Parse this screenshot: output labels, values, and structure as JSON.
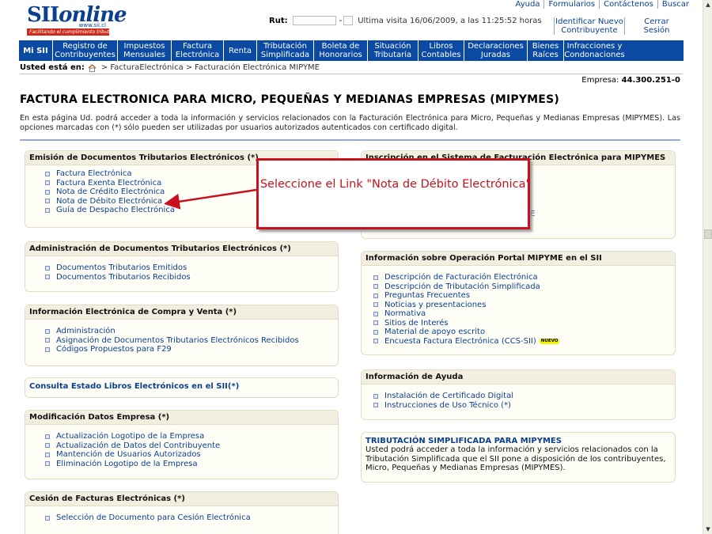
{
  "header": {
    "logo_word": "SIIonline",
    "logo_domain": "www.sii.cl",
    "logo_tagline": "Facilitando el cumplimiento tributario",
    "top_links": [
      "Ayuda",
      "Formularios",
      "Contáctenos",
      "Buscar"
    ],
    "rut_label": "Rut:",
    "rut_sep": "-",
    "last_visit": "Ultima visita 16/06/2009, a las 11:25:52 horas",
    "identify_link": "Identificar Nuevo Contribuyente",
    "logout_link": "Cerrar Sesión"
  },
  "nav": {
    "items": [
      "Mi SII",
      "Registro de Contribuyentes",
      "Impuestos Mensuales",
      "Factura Electrónica",
      "Renta",
      "Tributación Simplificada",
      "Boleta de Honorarios",
      "Situación Tributaria",
      "Libros Contables",
      "Declaraciones Juradas",
      "Bienes Raíces",
      "Infracciones y Condonaciones"
    ]
  },
  "breadcrumb": {
    "lead": "Usted está en:",
    "crumbs": [
      "FacturaElectrónica",
      "Facturación Electrónica MIPYME"
    ]
  },
  "empresa": {
    "label": "Empresa:",
    "value": "44.300.251-0"
  },
  "page": {
    "title": "FACTURA ELECTRONICA PARA MICRO, PEQUEÑAS Y MEDIANAS EMPRESAS (MIPYMES)",
    "intro": "En esta página Ud. podrá acceder a toda la información y servicios relacionados con la Facturación Electrónica para Micro, Pequeñas y Medianas Empresas (MIPYMES). Las opciones marcadas con (*) sólo pueden ser utilizadas por usuarios autorizados autenticados con certificado digital."
  },
  "panels_left": [
    {
      "title": "Emisión de Documentos Tributarios Electrónicos (*)",
      "links": [
        "Factura Electrónica",
        "Factura Exenta Electrónica",
        "Nota de Crédito Electrónica",
        "Nota de Débito Electrónica",
        "Guía de Despacho Electrónica"
      ]
    },
    {
      "title": "Administración de Documentos Tributarios Electrónicos (*)",
      "links": [
        "Documentos Tributarios Emitidos",
        "Documentos Tributarios Recibidos"
      ]
    },
    {
      "title": "Información Electrónica de Compra y Venta (*)",
      "links": [
        "Administración",
        "Asignación de Documentos Tributarios Electrónicos Recibidos",
        "Códigos Propuestos para F29"
      ]
    },
    {
      "title": "Consulta Estado Libros Electrónicos en el SII(*)",
      "links": []
    },
    {
      "title": "Modificación Datos Empresa (*)",
      "links": [
        "Actualización Logotipo de la Empresa",
        "Actualización de Datos del Contribuyente",
        "Mantención de Usuarios Autorizados",
        "Eliminación Logotipo de la Empresa"
      ]
    },
    {
      "title": "Cesión de Facturas Electrónicas (*)",
      "links": [
        "Selección de Documento para Cesión Electrónica"
      ]
    }
  ],
  "panels_right": [
    {
      "title": "Inscripción en el Sistema de Facturación Electrónica para MIPYMES",
      "links": [],
      "partial_link": "E"
    },
    {
      "title": "Información sobre Operación Portal MIPYME en el SII",
      "links": [
        "Descripción de Facturación Electrónica",
        "Descripción de Tributación Simplificada",
        "Preguntas Frecuentes",
        "Noticias y presentaciones",
        "Normativa",
        "Sitios de Interés",
        "Material de apoyo escrito",
        "Encuesta Factura Electrónica (CCS-SII)"
      ],
      "badge": "NUEVO"
    },
    {
      "title": "Información de Ayuda",
      "links": [
        "Instalación de Certificado Digital",
        "Instrucciones de Uso Técnico (*)"
      ]
    },
    {
      "title": "TRIBUTACIÓN SIMPLIFICADA PARA MIPYMES",
      "text": "Usted podrá acceder a toda la información y servicios relacionados con la Tributación Simplificada que el SII pone a disposición de los contribuyentes, Micro, Pequeñas y Medianas Empresas (MIPYMES)."
    }
  ],
  "callout": {
    "text": "Seleccione el Link \"Nota de Débito Electrónica\""
  },
  "colors": {
    "brand_blue": "#0b4aa2",
    "callout_red": "#c8101e",
    "link_blue": "#0a3f91",
    "panel_bg": "#fffef6"
  },
  "icons": {
    "home": "home-icon",
    "bullet": "square-bullet-icon"
  }
}
